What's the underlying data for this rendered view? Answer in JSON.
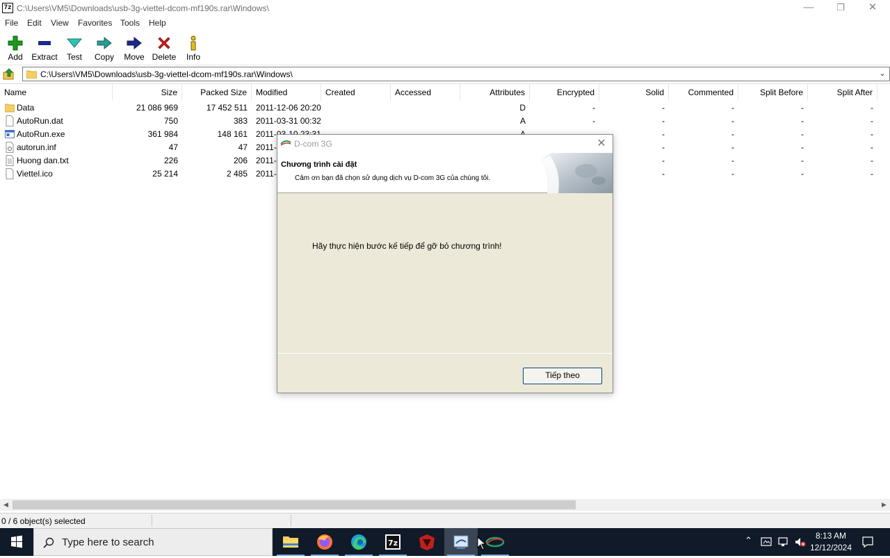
{
  "window": {
    "app_icon_text": "7z",
    "title": "C:\\Users\\VM5\\Downloads\\usb-3g-viettel-dcom-mf190s.rar\\Windows\\"
  },
  "menu": [
    "File",
    "Edit",
    "View",
    "Favorites",
    "Tools",
    "Help"
  ],
  "toolbar": [
    {
      "label": "Add",
      "icon": "add-icon"
    },
    {
      "label": "Extract",
      "icon": "extract-icon"
    },
    {
      "label": "Test",
      "icon": "test-icon"
    },
    {
      "label": "Copy",
      "icon": "copy-icon"
    },
    {
      "label": "Move",
      "icon": "move-icon"
    },
    {
      "label": "Delete",
      "icon": "delete-icon"
    },
    {
      "label": "Info",
      "icon": "info-icon"
    }
  ],
  "address": {
    "path": "C:\\Users\\VM5\\Downloads\\usb-3g-viettel-dcom-mf190s.rar\\Windows\\"
  },
  "columns": [
    "Name",
    "Size",
    "Packed Size",
    "Modified",
    "Created",
    "Accessed",
    "Attributes",
    "Encrypted",
    "Solid",
    "Commented",
    "Split Before",
    "Split After"
  ],
  "files": [
    {
      "name": "Data",
      "type": "folder",
      "size": "21 086 969",
      "packed": "17 452 511",
      "modified": "2011-12-06 20:20",
      "attributes": "D",
      "encrypted": "-",
      "solid": "-",
      "commented": "-",
      "split_before": "-",
      "split_after": "-"
    },
    {
      "name": "AutoRun.dat",
      "type": "file",
      "size": "750",
      "packed": "383",
      "modified": "2011-03-31 00:32",
      "attributes": "A",
      "encrypted": "-",
      "solid": "-",
      "commented": "-",
      "split_before": "-",
      "split_after": "-"
    },
    {
      "name": "AutoRun.exe",
      "type": "exe",
      "size": "361 984",
      "packed": "148 161",
      "modified": "2011-03-10 23:31",
      "attributes": "A",
      "encrypted": "-",
      "solid": "-",
      "commented": "-",
      "split_before": "-",
      "split_after": "-"
    },
    {
      "name": "autorun.inf",
      "type": "inf",
      "size": "47",
      "packed": "47",
      "modified": "2011-",
      "attributes": "",
      "encrypted": "-",
      "solid": "-",
      "commented": "-",
      "split_before": "-",
      "split_after": "-"
    },
    {
      "name": "Huong dan.txt",
      "type": "txt",
      "size": "226",
      "packed": "206",
      "modified": "2011-",
      "attributes": "",
      "encrypted": "-",
      "solid": "-",
      "commented": "-",
      "split_before": "-",
      "split_after": "-"
    },
    {
      "name": "Viettel.ico",
      "type": "file",
      "size": "25 214",
      "packed": "2 485",
      "modified": "2011-",
      "attributes": "",
      "encrypted": "-",
      "solid": "-",
      "commented": "-",
      "split_before": "-",
      "split_after": "-"
    }
  ],
  "status": {
    "selection": "0 / 6 object(s) selected"
  },
  "dialog": {
    "title": "D-com 3G",
    "header_title": "Chương trình cài đặt",
    "header_subtitle": "Cảm ơn bạn đã chọn sử dụng dịch vụ D-com 3G của chúng tôi.",
    "message": "Hãy thực hiện bước kế tiếp để gỡ bỏ chương trình!",
    "next_button": "Tiếp theo"
  },
  "taskbar": {
    "search_placeholder": "Type here to search",
    "time": "8:13 AM",
    "date": "12/12/2024"
  },
  "colors": {
    "taskbar_bg": "#101a28",
    "dialog_bg": "#ece9d8",
    "add_green": "#1a9b1a",
    "delete_red": "#d01c1c",
    "navy": "#1c2a8a"
  }
}
